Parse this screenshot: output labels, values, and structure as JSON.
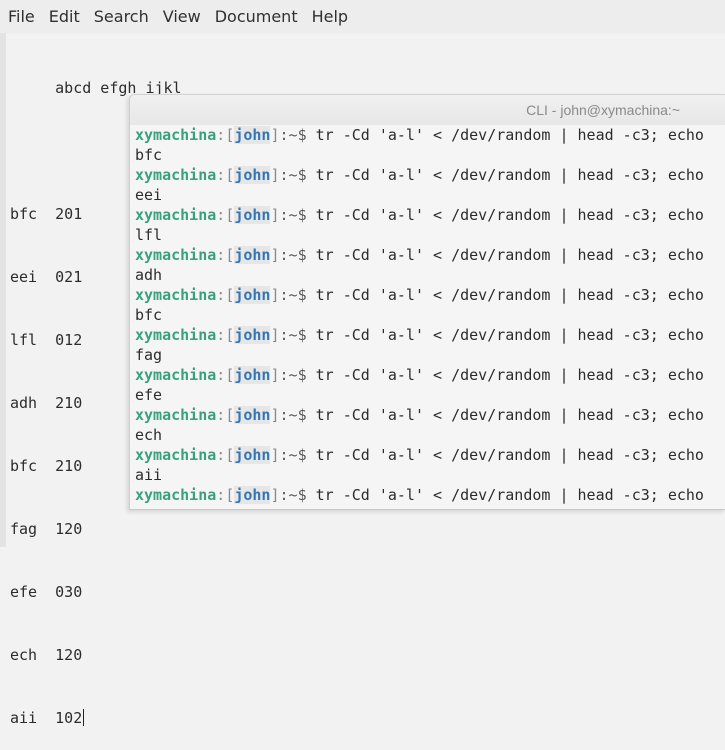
{
  "menubar": {
    "items": [
      "File",
      "Edit",
      "Search",
      "View",
      "Document",
      "Help"
    ]
  },
  "editor": {
    "lines": [
      "     abcd efgh ijkl",
      "",
      "bfc  201",
      "eei  021",
      "lfl  012",
      "adh  210",
      "bfc  210",
      "fag  120",
      "efe  030",
      "ech  120",
      "aii  102"
    ]
  },
  "terminal": {
    "title": "CLI - john@xymachina:~",
    "prompt": {
      "host": "xymachina",
      "colon": ":",
      "lbracket": "[",
      "user": "john",
      "rbracket": "]",
      "path": ":~",
      "dollar": "$"
    },
    "command": " tr -Cd 'a-l' < /dev/random | head -c3; echo",
    "outputs": [
      "bfc",
      "eei",
      "lfl",
      "adh",
      "bfc",
      "fag",
      "efe",
      "ech",
      "aii"
    ]
  }
}
